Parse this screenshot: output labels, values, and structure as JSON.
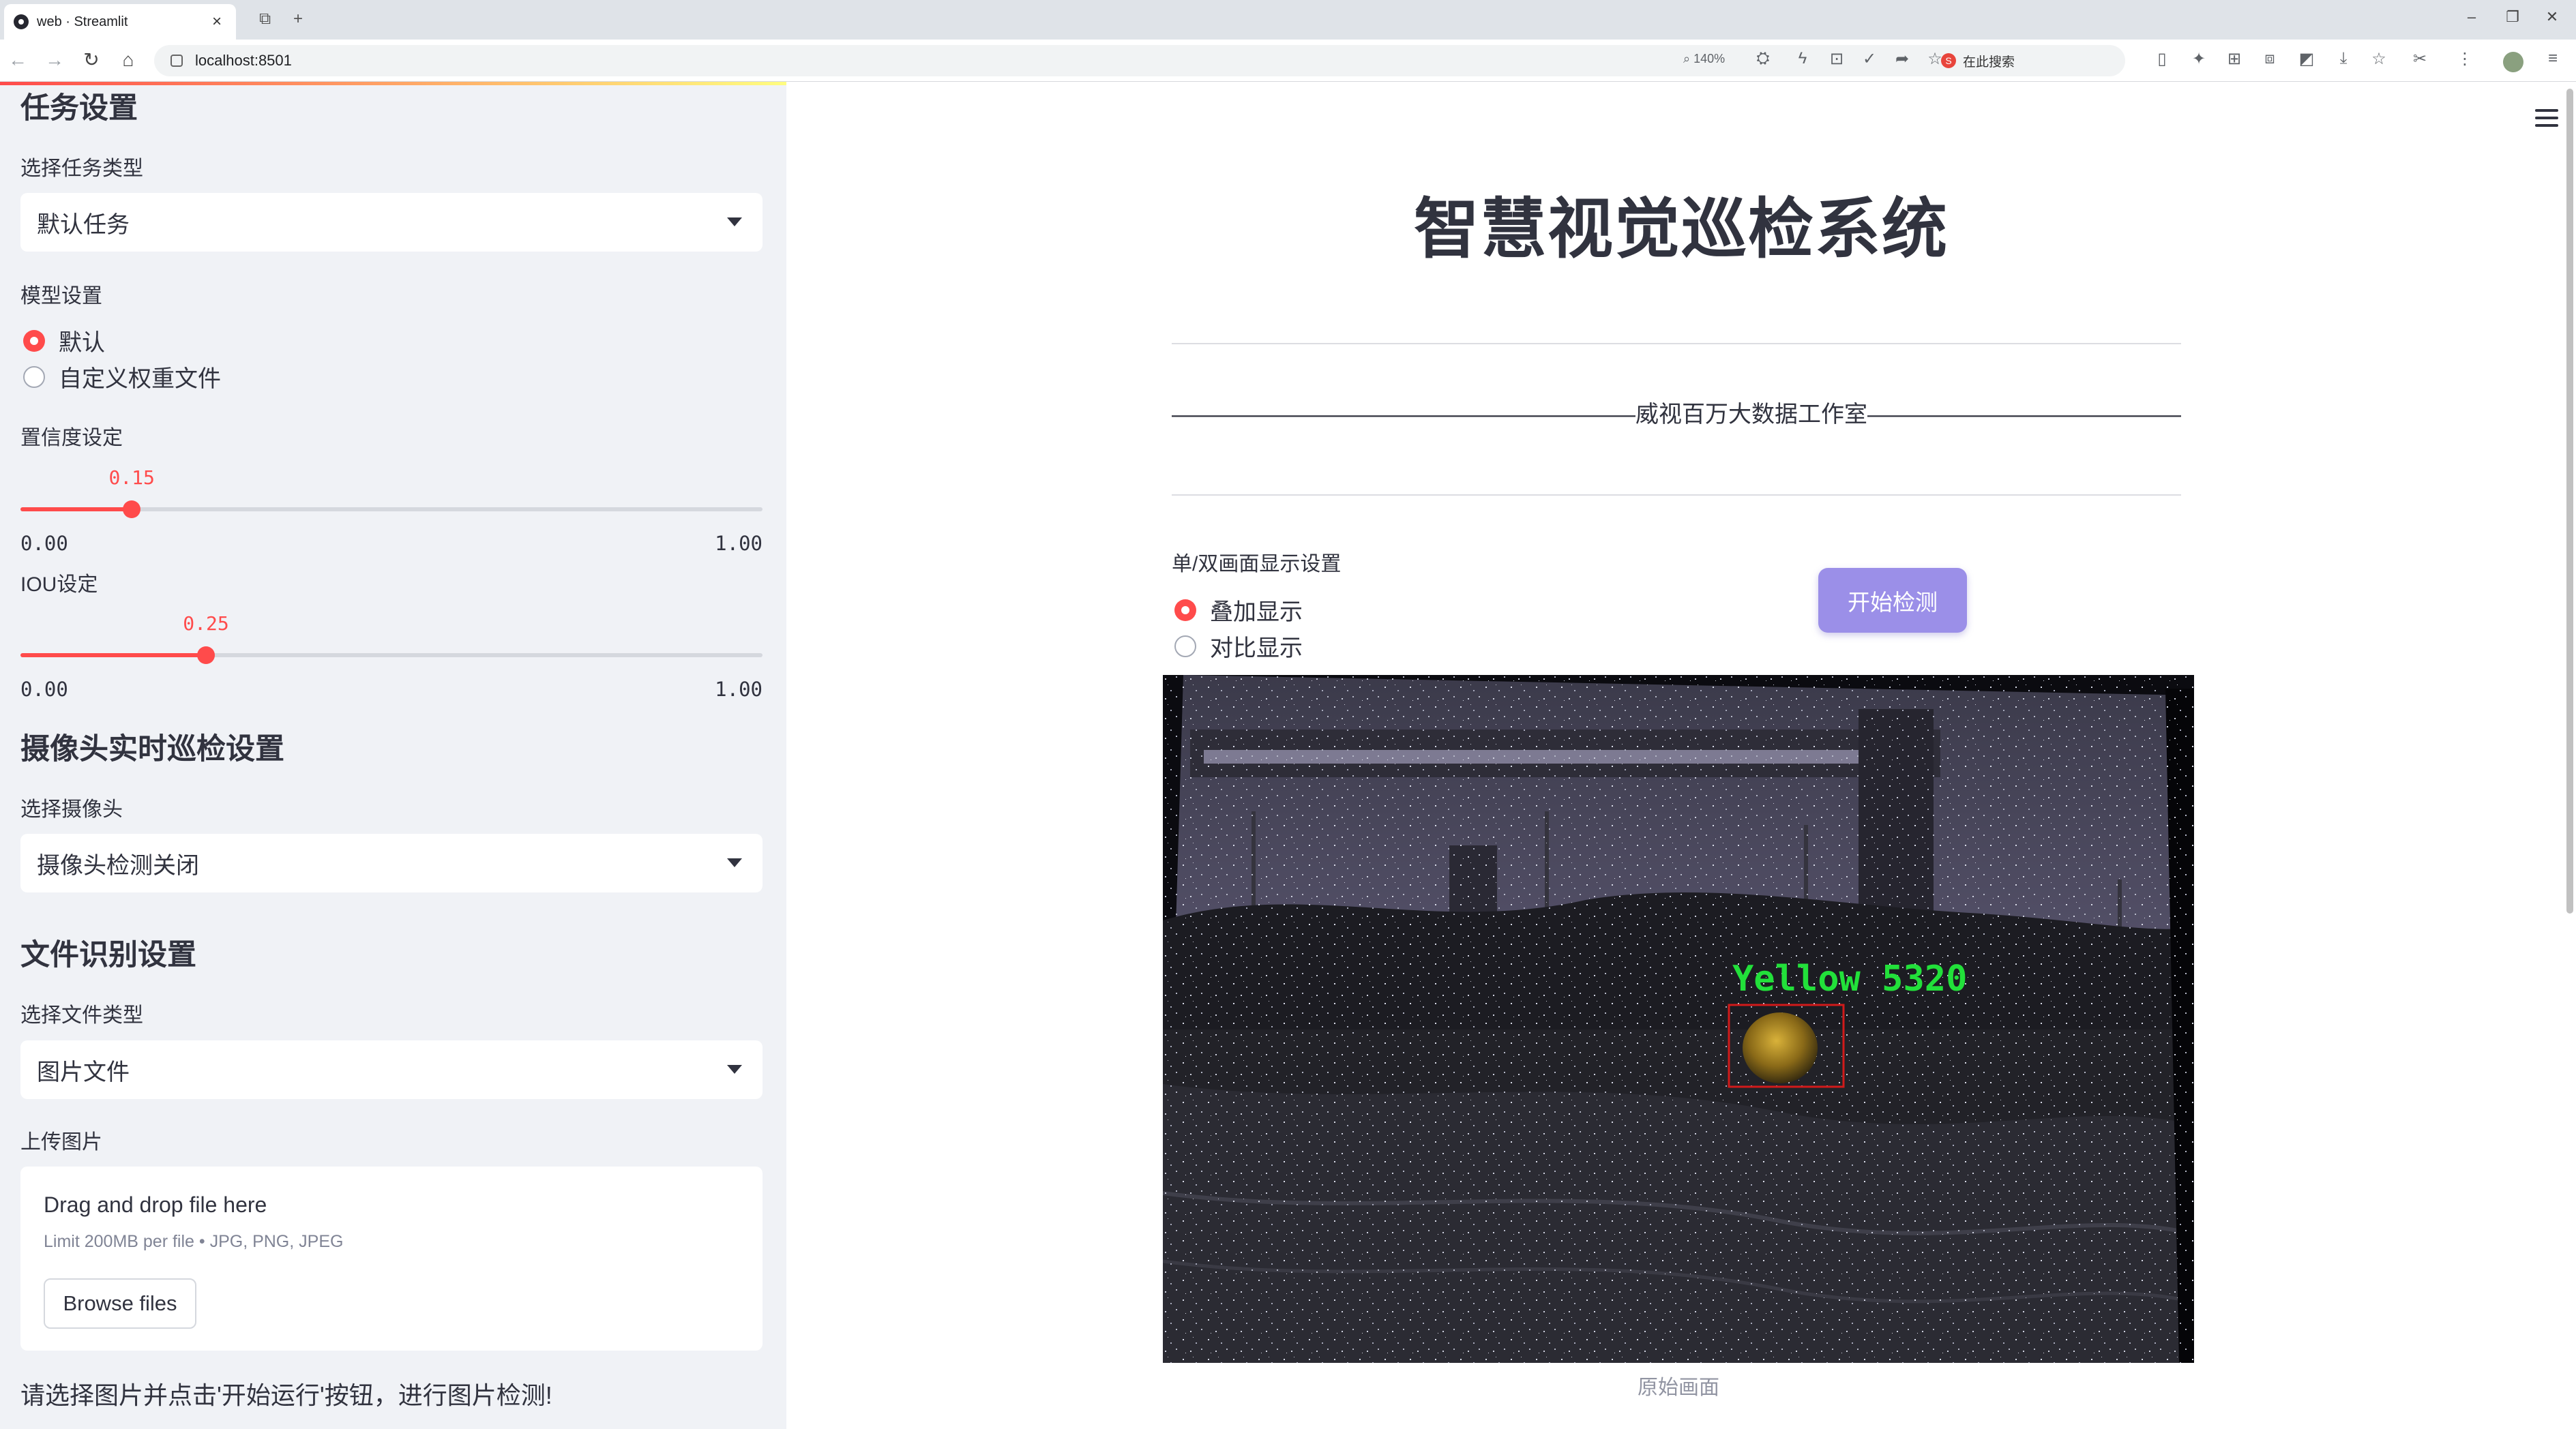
{
  "browser": {
    "tab_title": "web · Streamlit",
    "url": "localhost:8501",
    "zoom": "140%",
    "search_label": "在此搜索"
  },
  "sidebar": {
    "task_section_title": "任务设置",
    "task_type_label": "选择任务类型",
    "task_type_value": "默认任务",
    "model_label": "模型设置",
    "model_options": [
      "默认",
      "自定义权重文件"
    ],
    "model_selected": 0,
    "confidence_label": "置信度设定",
    "confidence_value": "0.15",
    "confidence_fraction": 0.15,
    "confidence_min": "0.00",
    "confidence_max": "1.00",
    "iou_label": "IOU设定",
    "iou_value": "0.25",
    "iou_fraction": 0.25,
    "iou_min": "0.00",
    "iou_max": "1.00",
    "camera_section_title": "摄像头实时巡检设置",
    "camera_label": "选择摄像头",
    "camera_value": "摄像头检测关闭",
    "file_section_title": "文件识别设置",
    "file_type_label": "选择文件类型",
    "file_type_value": "图片文件",
    "upload_label": "上传图片",
    "upload_title": "Drag and drop file here",
    "upload_limit": "Limit 200MB per file • JPG, PNG, JPEG",
    "browse_button": "Browse files",
    "footer_note": "请选择图片并点击'开始运行'按钮，进行图片检测!"
  },
  "main": {
    "title": "智慧视觉巡检系统",
    "subtitle": "————————————————————威视百万大数据工作室—————————————————————",
    "display_label": "单/双画面显示设置",
    "display_options": [
      "叠加显示",
      "对比显示"
    ],
    "display_selected": 0,
    "start_button": "开始检测",
    "detection_label": "Yellow 5320",
    "image_caption": "原始画面"
  },
  "colors": {
    "accent": "#ff4b4b",
    "button": "#9b8fe8",
    "detection_text": "#22e03a",
    "detection_box": "#d11a1a"
  }
}
